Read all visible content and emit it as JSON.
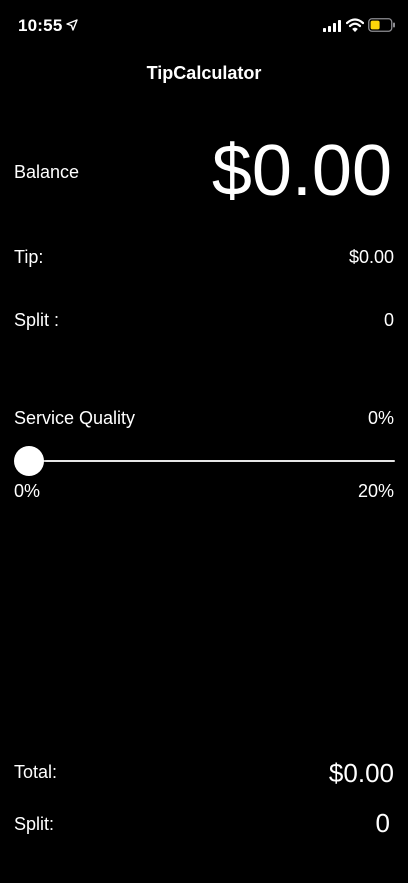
{
  "status_bar": {
    "time": "10:55"
  },
  "nav": {
    "title": "TipCalculator"
  },
  "balance": {
    "label": "Balance",
    "value": "$0.00"
  },
  "tip": {
    "label": "Tip:",
    "value": "$0.00"
  },
  "split_top": {
    "label": "Split :",
    "value": "0"
  },
  "service_quality": {
    "label": "Service Quality",
    "value": "0%",
    "slider_level": 0,
    "min_label": "0%",
    "max_label": "20%"
  },
  "total": {
    "label": "Total:",
    "value": "$0.00"
  },
  "split_bottom": {
    "label": "Split:",
    "value": "0"
  },
  "colors": {
    "background": "#000000",
    "text": "#ffffff",
    "battery_fill": "#ffd60a"
  },
  "icons": [
    "location-arrow-icon",
    "cellular-signal-icon",
    "wifi-icon",
    "battery-icon"
  ]
}
